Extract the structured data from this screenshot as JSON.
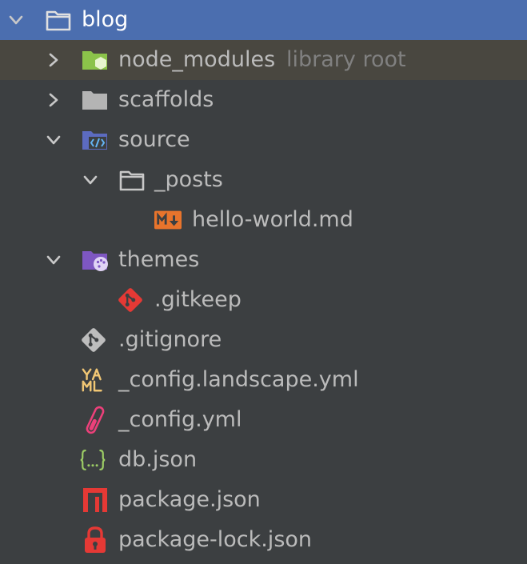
{
  "tree": {
    "root": {
      "label": "blog"
    },
    "node_modules": {
      "label": "node_modules",
      "tag": "library root"
    },
    "scaffolds": {
      "label": "scaffolds"
    },
    "source": {
      "label": "source"
    },
    "posts": {
      "label": "_posts"
    },
    "hello_world": {
      "label": "hello-world.md"
    },
    "themes": {
      "label": "themes"
    },
    "gitkeep": {
      "label": ".gitkeep"
    },
    "gitignore": {
      "label": ".gitignore"
    },
    "config_landscape": {
      "label": "_config.landscape.yml"
    },
    "config": {
      "label": "_config.yml"
    },
    "db": {
      "label": "db.json"
    },
    "package": {
      "label": "package.json"
    },
    "package_lock": {
      "label": "package-lock.json"
    }
  },
  "icons": {
    "root": "folder-open-icon",
    "node_modules": "node-folder-icon",
    "scaffolds": "folder-icon",
    "source": "source-folder-icon",
    "posts": "folder-open-icon",
    "hello_world": "markdown-icon",
    "themes": "themes-folder-icon",
    "gitkeep": "git-icon",
    "gitignore": "git-icon",
    "config_landscape": "yaml-icon",
    "config": "config-icon",
    "db": "json-icon",
    "package": "npm-icon",
    "package_lock": "lock-icon"
  },
  "colors": {
    "background": "#3c3f41",
    "selected": "#4b6eaf",
    "hover": "#494740",
    "text": "#bbbbbb",
    "muted": "#808080"
  }
}
